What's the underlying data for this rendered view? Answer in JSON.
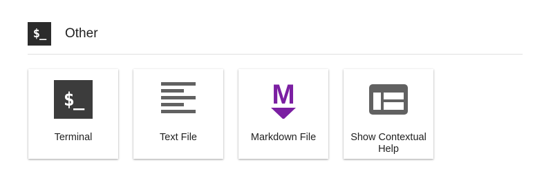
{
  "section": {
    "title": "Other",
    "icon_glyph": "$_",
    "icon_name": "terminal-icon"
  },
  "cards": [
    {
      "label": "Terminal",
      "icon": "terminal-icon",
      "icon_glyph": "$_"
    },
    {
      "label": "Text File",
      "icon": "text-file-icon"
    },
    {
      "label": "Markdown File",
      "icon": "markdown-icon",
      "icon_glyph": "M"
    },
    {
      "label": "Show Contextual Help",
      "icon": "contextual-help-icon"
    }
  ],
  "colors": {
    "terminal_bg": "#3c3c3c",
    "icon_gray": "#616161",
    "markdown_purple": "#7b1fa2",
    "divider": "#e0e0e0"
  }
}
